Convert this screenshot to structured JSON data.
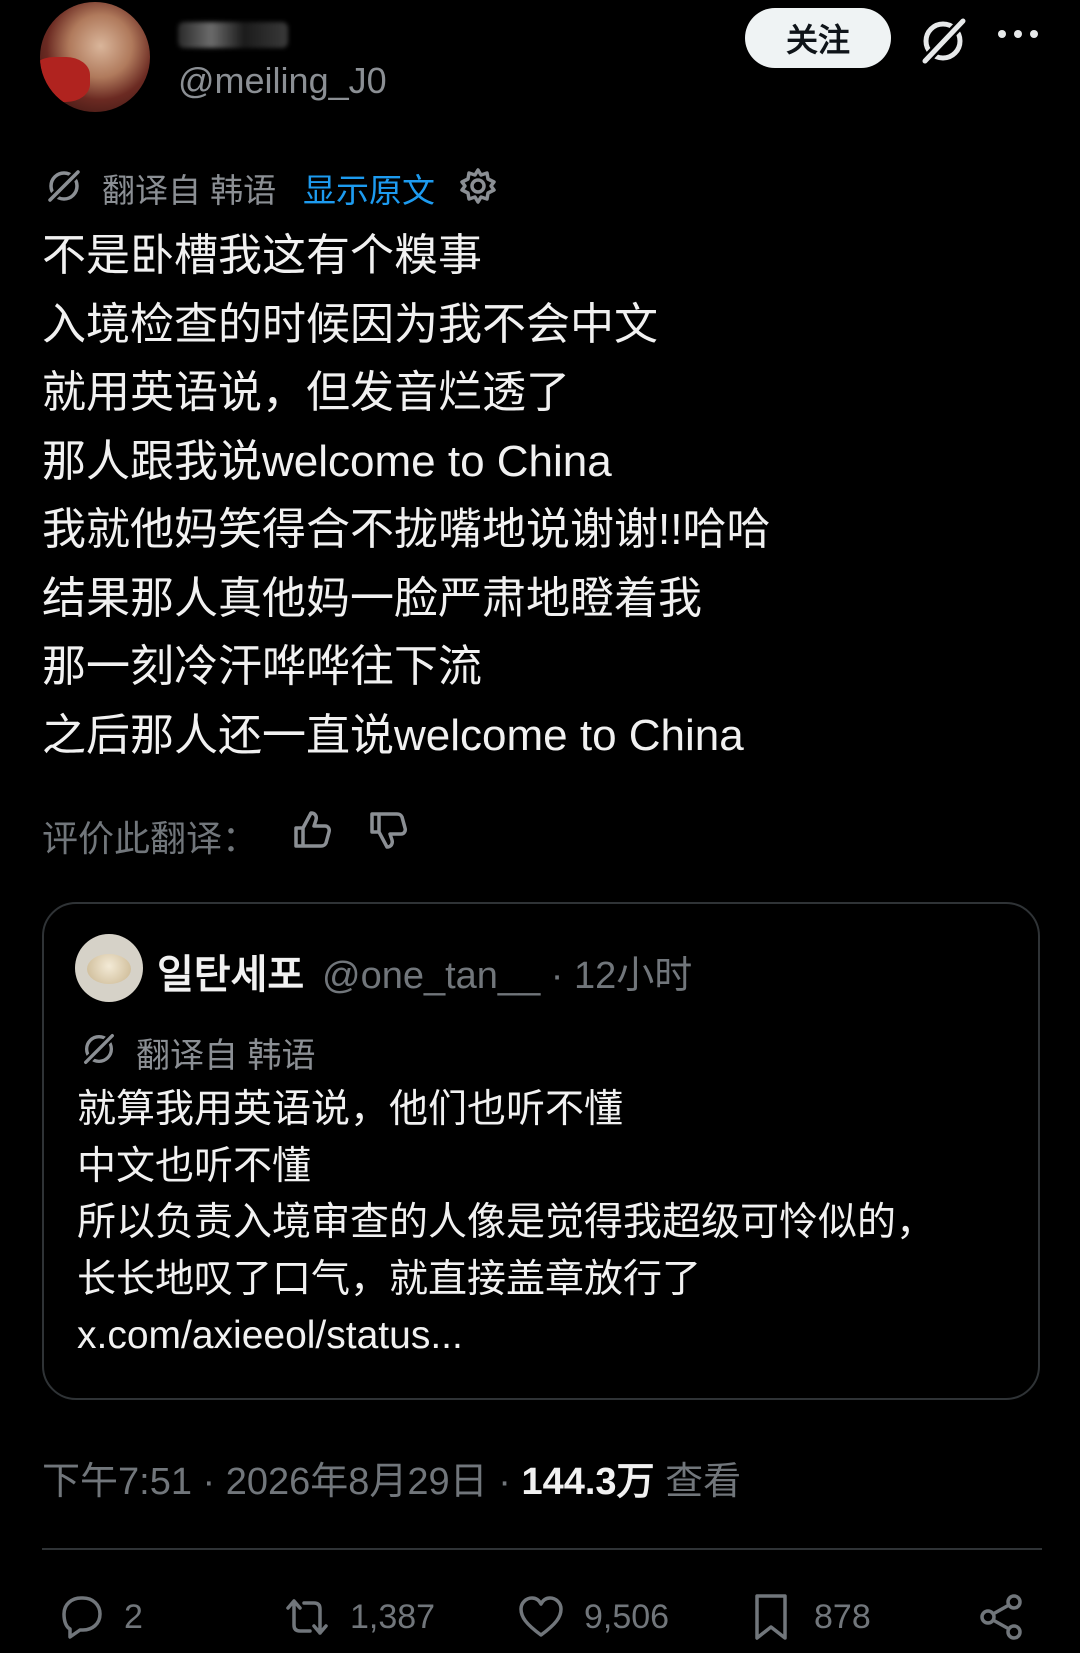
{
  "header": {
    "handle": "@meiling_J0",
    "follow_label": "关注",
    "grok_icon": "grok-icon",
    "more_icon": "more-horizontal-icon"
  },
  "translation": {
    "label": "翻译自 韩语",
    "show_original": "显示原文",
    "settings_icon": "gear-icon"
  },
  "tweet": {
    "lines": [
      "不是卧槽我这有个糗事",
      "入境检查的时候因为我不会中文",
      "就用英语说，但发音烂透了",
      "那人跟我说welcome to China",
      "我就他妈笑得合不拢嘴地说谢谢!!哈哈",
      "结果那人真他妈一脸严肃地瞪着我",
      "那一刻冷汗哗哗往下流",
      "之后那人还一直说welcome to China"
    ]
  },
  "rating": {
    "label": "评价此翻译："
  },
  "quote": {
    "name": "일탄세포",
    "meta": "@one_tan__ · 12小时",
    "translation_label": "翻译自 韩语",
    "lines": [
      "就算我用英语说，他们也听不懂",
      "中文也听不懂",
      "所以负责入境审查的人像是觉得我超级可怜似的，",
      "长长地叹了口气，就直接盖章放行了",
      "x.com/axieeol/status..."
    ]
  },
  "timestamp": {
    "time": "下午7:51 · 2026年8月29日 · ",
    "views": "144.3万",
    "views_label": " 查看"
  },
  "actions": {
    "replies": "2",
    "reposts": "1,387",
    "likes": "9,506",
    "bookmarks": "878"
  },
  "colors": {
    "background": "#000000",
    "link": "#1d9bf0",
    "muted": "#71767b"
  }
}
